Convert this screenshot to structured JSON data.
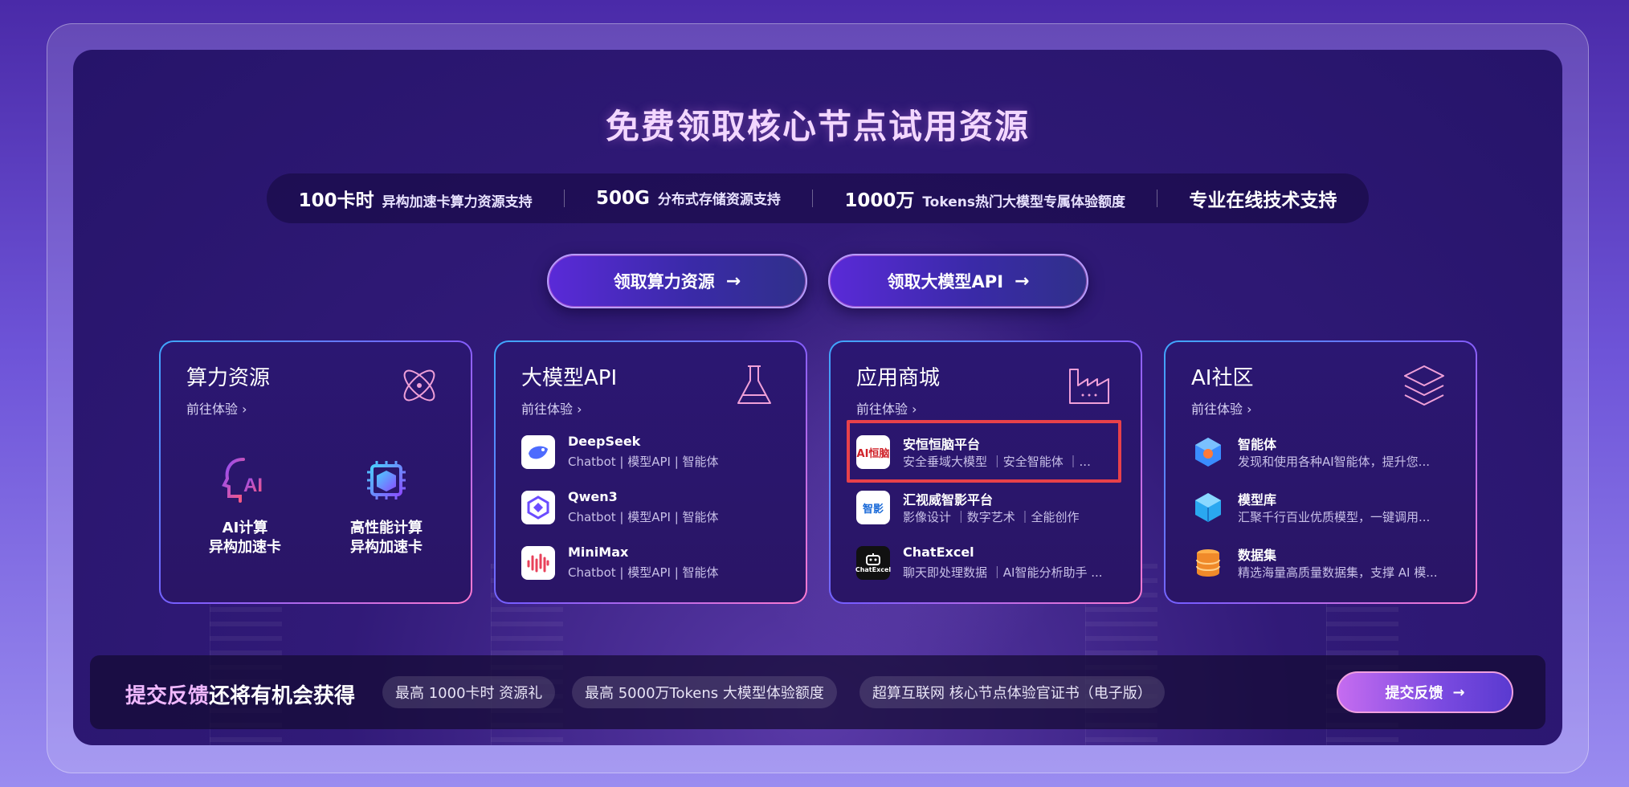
{
  "headline": "免费领取核心节点试用资源",
  "benefits": [
    {
      "num": "100卡时",
      "text": "异构加速卡算力资源支持"
    },
    {
      "num": "500G",
      "text": "分布式存储资源支持"
    },
    {
      "num": "1000万",
      "text": "Tokens热门大模型专属体验额度"
    },
    {
      "num": "专业在线技术支持",
      "text": ""
    }
  ],
  "cta": {
    "compute_label": "领取算力资源",
    "api_label": "领取大模型API",
    "arrow": "→"
  },
  "cards": {
    "compute": {
      "title": "算力资源",
      "link": "前往体验 ›",
      "items": [
        {
          "line1": "AI计算",
          "line2": "异构加速卡"
        },
        {
          "line1": "高性能计算",
          "line2": "异构加速卡"
        }
      ]
    },
    "api": {
      "title": "大模型API",
      "link": "前往体验 ›",
      "items": [
        {
          "name": "DeepSeek",
          "desc": "Chatbot | 模型API | 智能体"
        },
        {
          "name": "Qwen3",
          "desc": "Chatbot | 模型API | 智能体"
        },
        {
          "name": "MiniMax",
          "desc": "Chatbot | 模型API | 智能体"
        }
      ]
    },
    "store": {
      "title": "应用商城",
      "link": "前往体验 ›",
      "items": [
        {
          "name": "安恒恒脑平台",
          "desc": "安全垂域大模型 ｜安全智能体 ｜...",
          "logo": "AI恒脑"
        },
        {
          "name": "汇视威智影平台",
          "desc": "影像设计 ｜数字艺术 ｜全能创作",
          "logo": "智影"
        },
        {
          "name": "ChatExcel",
          "desc": "聊天即处理数据 ｜AI智能分析助手 ...",
          "logo": "ChatExcel"
        }
      ]
    },
    "community": {
      "title": "AI社区",
      "link": "前往体验 ›",
      "items": [
        {
          "name": "智能体",
          "desc": "发现和使用各种AI智能体，提升您..."
        },
        {
          "name": "模型库",
          "desc": "汇聚千行百业优质模型，一键调用..."
        },
        {
          "name": "数据集",
          "desc": "精选海量高质量数据集，支撑 AI 模..."
        }
      ]
    }
  },
  "feedback": {
    "title_accent": "提交反馈",
    "title_rest": "还将有机会获得",
    "chips": [
      "最高 1000卡时 资源礼",
      "最高 5000万Tokens 大模型体验额度",
      "超算互联网 核心节点体验官证书（电子版）"
    ],
    "button_label": "提交反馈",
    "arrow": "→"
  },
  "colors": {
    "highlight": "#e8414a",
    "accent_text": "#f0b8ff"
  }
}
